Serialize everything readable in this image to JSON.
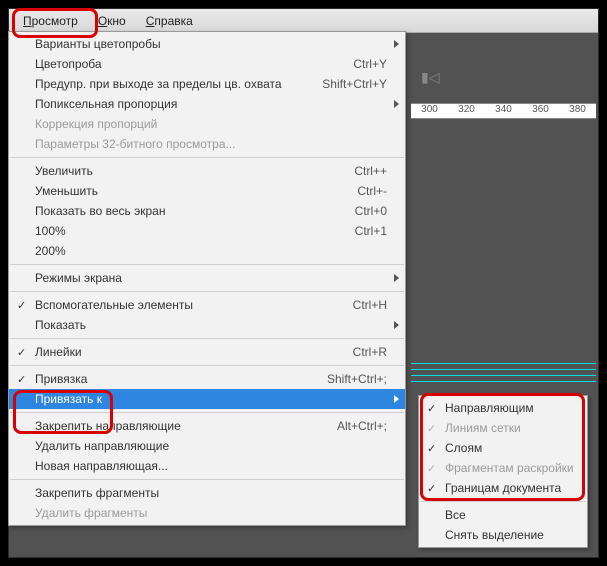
{
  "menubar": {
    "view": "Просмотр",
    "window": "Окно",
    "help": "Справка"
  },
  "ruler": [
    "300",
    "320",
    "340",
    "360",
    "380"
  ],
  "menu": [
    {
      "t": "item",
      "label": "Варианты цветопробы",
      "submenu": true
    },
    {
      "t": "item",
      "label": "Цветопроба",
      "shortcut": "Ctrl+Y"
    },
    {
      "t": "item",
      "label": "Предупр. при выходе за пределы цв. охвата",
      "shortcut": "Shift+Ctrl+Y"
    },
    {
      "t": "item",
      "label": "Попиксельная пропорция",
      "submenu": true
    },
    {
      "t": "item",
      "label": "Коррекция пропорций",
      "disabled": true
    },
    {
      "t": "item",
      "label": "Параметры 32-битного просмотра...",
      "disabled": true
    },
    {
      "t": "sep"
    },
    {
      "t": "item",
      "label": "Увеличить",
      "shortcut": "Ctrl++"
    },
    {
      "t": "item",
      "label": "Уменьшить",
      "shortcut": "Ctrl+-"
    },
    {
      "t": "item",
      "label": "Показать во весь экран",
      "shortcut": "Ctrl+0"
    },
    {
      "t": "item",
      "label": "100%",
      "shortcut": "Ctrl+1"
    },
    {
      "t": "item",
      "label": "200%"
    },
    {
      "t": "sep"
    },
    {
      "t": "item",
      "label": "Режимы экрана",
      "submenu": true
    },
    {
      "t": "sep"
    },
    {
      "t": "item",
      "label": "Вспомогательные элементы",
      "shortcut": "Ctrl+H",
      "checked": true
    },
    {
      "t": "item",
      "label": "Показать",
      "submenu": true
    },
    {
      "t": "sep"
    },
    {
      "t": "item",
      "label": "Линейки",
      "shortcut": "Ctrl+R",
      "checked": true
    },
    {
      "t": "sep"
    },
    {
      "t": "item",
      "label": "Привязка",
      "shortcut": "Shift+Ctrl+;",
      "checked": true
    },
    {
      "t": "item",
      "label": "Привязать к",
      "submenu": true,
      "highlight": true
    },
    {
      "t": "sep"
    },
    {
      "t": "item",
      "label": "Закрепить направляющие",
      "shortcut": "Alt+Ctrl+;"
    },
    {
      "t": "item",
      "label": "Удалить направляющие"
    },
    {
      "t": "item",
      "label": "Новая направляющая..."
    },
    {
      "t": "sep"
    },
    {
      "t": "item",
      "label": "Закрепить фрагменты"
    },
    {
      "t": "item",
      "label": "Удалить фрагменты",
      "disabled": true
    }
  ],
  "submenu": [
    {
      "label": "Направляющим",
      "checked": true
    },
    {
      "label": "Линиям сетки",
      "checked": true,
      "disabled": true
    },
    {
      "label": "Слоям",
      "checked": true
    },
    {
      "label": "Фрагментам раскройки",
      "checked": true,
      "disabled": true
    },
    {
      "label": "Границам документа",
      "checked": true
    },
    {
      "t": "sep"
    },
    {
      "label": "Все"
    },
    {
      "label": "Снять выделение"
    }
  ]
}
